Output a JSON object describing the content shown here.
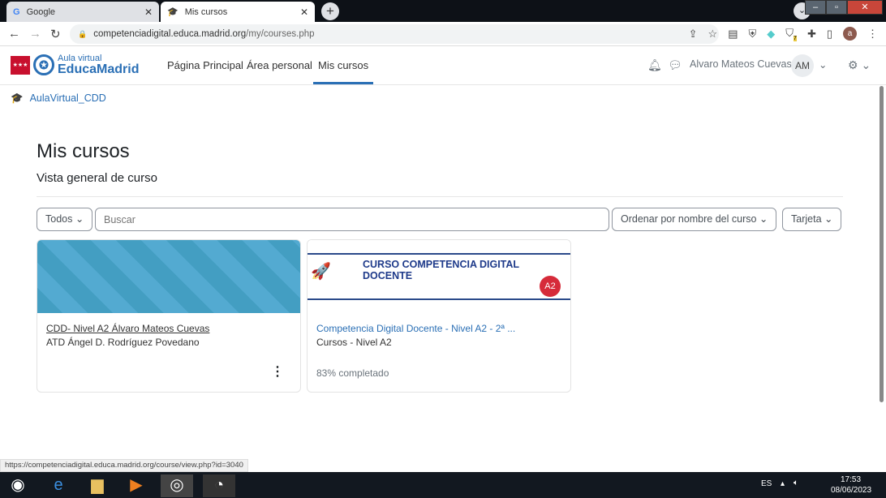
{
  "browser": {
    "tabs": [
      {
        "label": "Google",
        "icon": "google-icon"
      },
      {
        "label": "Mis cursos",
        "icon": "graduation-cap-icon"
      }
    ],
    "url": {
      "host": "competenciadigital.educa.madrid.org",
      "path": "/my/courses.php"
    },
    "status_url": "https://competenciadigital.educa.madrid.org/course/view.php?id=3040",
    "profile_initial": "a",
    "extension_badge": "7"
  },
  "site": {
    "logo_small": "Aula virtual",
    "logo_big": "EducaMadrid",
    "menu": [
      "Página Principal",
      "Área personal",
      "Mis cursos"
    ],
    "active_menu": "Mis cursos",
    "user_name": "Alvaro Mateos Cuevas",
    "user_initials": "AM"
  },
  "breadcrumb": "AulaVirtual_CDD",
  "page": {
    "title": "Mis cursos",
    "subtitle": "Vista general de curso"
  },
  "filters": {
    "grouping": "Todos",
    "search_placeholder": "Buscar",
    "sort": "Ordenar por nombre del curso",
    "view": "Tarjeta"
  },
  "courses": [
    {
      "name": "CDD- Nivel A2 Álvaro Mateos Cuevas",
      "category": "ATD Ángel D. Rodríguez Povedano"
    },
    {
      "name": "Competencia Digital Docente - Nivel A2 - 2ª ...",
      "category": "Cursos - Nivel A2",
      "banner_title": "CURSO COMPETENCIA DIGITAL DOCENTE",
      "badge": "A2",
      "progress_text": "83% completado",
      "progress": 83
    }
  ],
  "taskbar": {
    "lang": "ES",
    "time": "17:53",
    "date": "08/06/2023"
  },
  "colors": {
    "accent": "#2a6fb5",
    "brand_red": "#c8102e"
  }
}
